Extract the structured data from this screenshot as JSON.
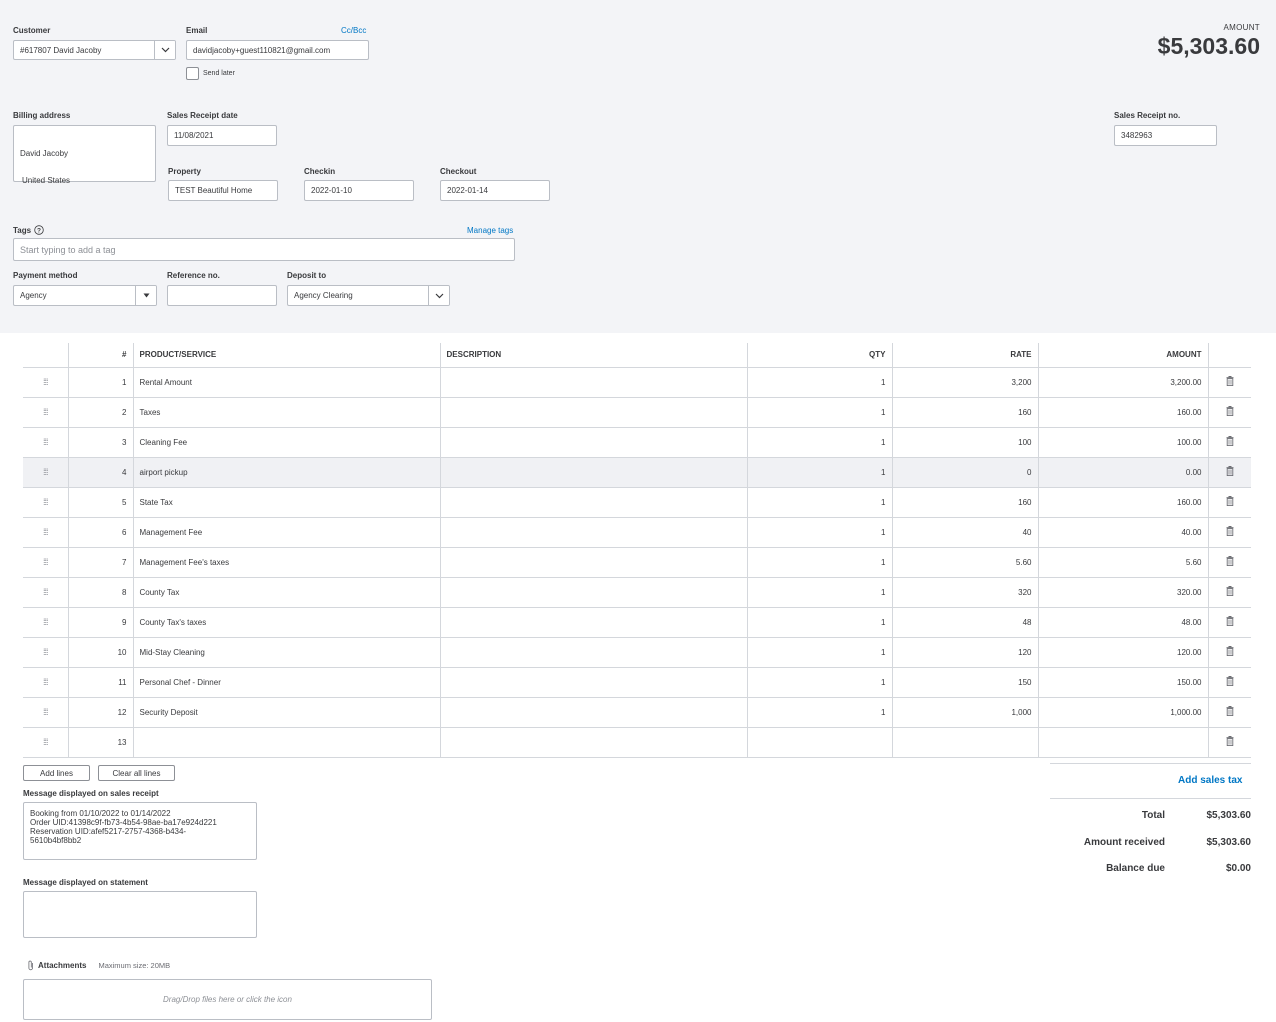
{
  "header": {
    "customer_label": "Customer",
    "customer_value": "#617807 David Jacoby",
    "email_label": "Email",
    "cc_bcc": "Cc/Bcc",
    "email_value": "davidjacoby+guest110821@gmail.com",
    "send_later": "Send later",
    "amount_caption": "AMOUNT",
    "amount_value": "$5,303.60"
  },
  "billing": {
    "label": "Billing address",
    "line1": "David Jacoby",
    "line2": "United States"
  },
  "receipt": {
    "date_label": "Sales Receipt date",
    "date_value": "11/08/2021",
    "no_label": "Sales Receipt no.",
    "no_value": "3482963"
  },
  "stay": {
    "property_label": "Property",
    "property_value": "TEST Beautiful Home",
    "checkin_label": "Checkin",
    "checkin_value": "2022-01-10",
    "checkout_label": "Checkout",
    "checkout_value": "2022-01-14"
  },
  "tags": {
    "label": "Tags",
    "manage": "Manage tags",
    "placeholder": "Start typing to add a tag"
  },
  "payment": {
    "method_label": "Payment method",
    "method_value": "Agency",
    "ref_label": "Reference no.",
    "ref_value": "",
    "deposit_label": "Deposit to",
    "deposit_value": "Agency Clearing"
  },
  "table": {
    "headers": [
      "#",
      "PRODUCT/SERVICE",
      "DESCRIPTION",
      "QTY",
      "RATE",
      "AMOUNT"
    ],
    "rows": [
      {
        "n": "1",
        "product": "Rental Amount",
        "desc": "",
        "qty": "1",
        "rate": "3,200",
        "amount": "3,200.00"
      },
      {
        "n": "2",
        "product": "Taxes",
        "desc": "",
        "qty": "1",
        "rate": "160",
        "amount": "160.00"
      },
      {
        "n": "3",
        "product": "Cleaning Fee",
        "desc": "",
        "qty": "1",
        "rate": "100",
        "amount": "100.00"
      },
      {
        "n": "4",
        "product": "airport pickup",
        "desc": "",
        "qty": "1",
        "rate": "0",
        "amount": "0.00"
      },
      {
        "n": "5",
        "product": "State Tax",
        "desc": "",
        "qty": "1",
        "rate": "160",
        "amount": "160.00"
      },
      {
        "n": "6",
        "product": "Management Fee",
        "desc": "",
        "qty": "1",
        "rate": "40",
        "amount": "40.00"
      },
      {
        "n": "7",
        "product": "Management Fee's taxes",
        "desc": "",
        "qty": "1",
        "rate": "5.60",
        "amount": "5.60"
      },
      {
        "n": "8",
        "product": "County Tax",
        "desc": "",
        "qty": "1",
        "rate": "320",
        "amount": "320.00"
      },
      {
        "n": "9",
        "product": "County Tax's taxes",
        "desc": "",
        "qty": "1",
        "rate": "48",
        "amount": "48.00"
      },
      {
        "n": "10",
        "product": "Mid-Stay Cleaning",
        "desc": "",
        "qty": "1",
        "rate": "120",
        "amount": "120.00"
      },
      {
        "n": "11",
        "product": "Personal Chef - Dinner",
        "desc": "",
        "qty": "1",
        "rate": "150",
        "amount": "150.00"
      },
      {
        "n": "12",
        "product": "Security Deposit",
        "desc": "",
        "qty": "1",
        "rate": "1,000",
        "amount": "1,000.00"
      },
      {
        "n": "13",
        "product": "",
        "desc": "",
        "qty": "",
        "rate": "",
        "amount": ""
      }
    ]
  },
  "actions": {
    "add_lines": "Add lines",
    "clear_lines": "Clear all lines",
    "add_sales_tax": "Add sales tax"
  },
  "messages": {
    "receipt_label": "Message displayed on sales receipt",
    "receipt_text": "Booking from 01/10/2022 to 01/14/2022\nOrder UID:41398c9f-fb73-4b54-98ae-ba17e924d221\nReservation UID:afef5217-2757-4368-b434-\n5610b4bf8bb2",
    "statement_label": "Message displayed on statement",
    "statement_text": ""
  },
  "totals": {
    "total_label": "Total",
    "total_value": "$5,303.60",
    "received_label": "Amount received",
    "received_value": "$5,303.60",
    "balance_label": "Balance due",
    "balance_value": "$0.00"
  },
  "attachments": {
    "label": "Attachments",
    "max_size": "Maximum size: 20MB",
    "drop_text": "Drag/Drop files here or click the icon"
  }
}
